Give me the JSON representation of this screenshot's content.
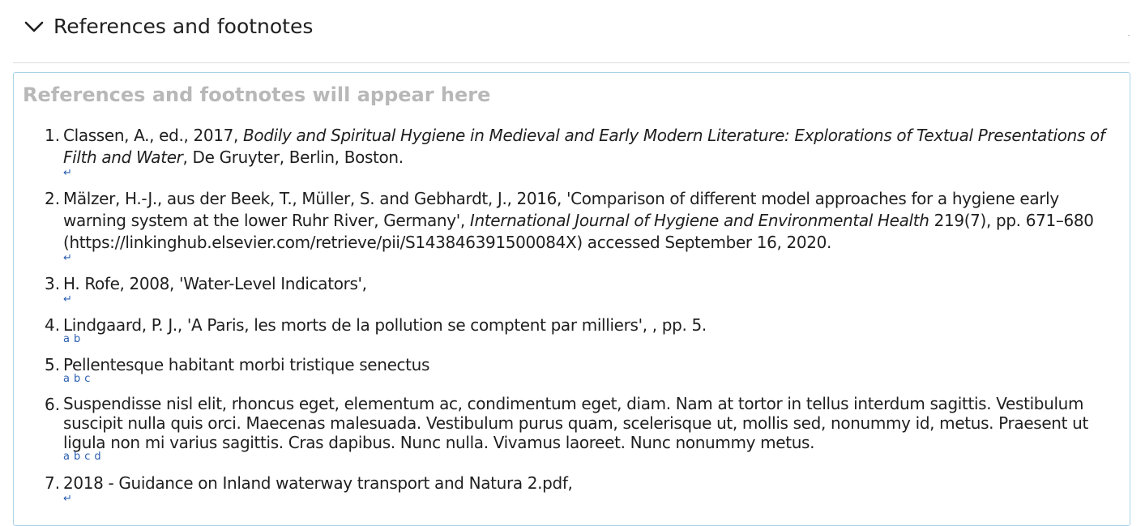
{
  "section": {
    "title": "References and footnotes",
    "toggle_icon": "chevron-down-icon"
  },
  "panel": {
    "placeholder": "References and footnotes will appear here",
    "border_color": "#a9d3e6"
  },
  "references": [
    {
      "number": "1.",
      "parts": {
        "a": "Classen, A., ed., 2017, ",
        "b": "Bodily and Spiritual Hygiene in Medieval and Early Modern Literature: Explorations of Textual Presentations of Filth and Water",
        "c": ", De Gruyter, Berlin, Boston."
      },
      "backrefs": [
        "↵"
      ]
    },
    {
      "number": "2.",
      "parts": {
        "a": "Mälzer, H.-J., aus der Beek, T., Müller, S. and Gebhardt, J., 2016, 'Comparison of different model approaches for a hygiene early warning system at the lower Ruhr River, Germany', ",
        "b": "International Journal of Hygiene and Environmental Health",
        "c": " 219(7), pp. 671–680 (https://linkinghub.elsevier.com/retrieve/pii/S143846391500084X) accessed September 16, 2020."
      },
      "backrefs": [
        "↵"
      ]
    },
    {
      "number": "3.",
      "text": "H. Rofe, 2008, 'Water-Level Indicators',",
      "backrefs": [
        "↵"
      ]
    },
    {
      "number": "4.",
      "text": "Lindgaard, P. J., 'A Paris, les morts de la pollution se comptent par milliers', , pp. 5.",
      "backrefs": [
        "a",
        "b"
      ]
    },
    {
      "number": "5.",
      "text": "Pellentesque habitant morbi tristique senectus",
      "backrefs": [
        "a",
        "b",
        "c"
      ]
    },
    {
      "number": "6.",
      "text": "Suspendisse nisl elit, rhoncus eget, elementum ac, condimentum eget, diam. Nam at tortor in tellus interdum sagittis. Vestibulum suscipit nulla quis orci. Maecenas malesuada. Vestibulum purus quam, scelerisque ut, mollis sed, nonummy id, metus. Praesent ut ligula non mi varius sagittis. Cras dapibus. Nunc nulla. Vivamus laoreet. Nunc nonummy metus.",
      "backrefs": [
        "a",
        "b",
        "c",
        "d"
      ]
    },
    {
      "number": "7.",
      "text": "2018 - Guidance on Inland waterway transport and Natura 2.pdf,",
      "backrefs": [
        "↵"
      ]
    }
  ]
}
